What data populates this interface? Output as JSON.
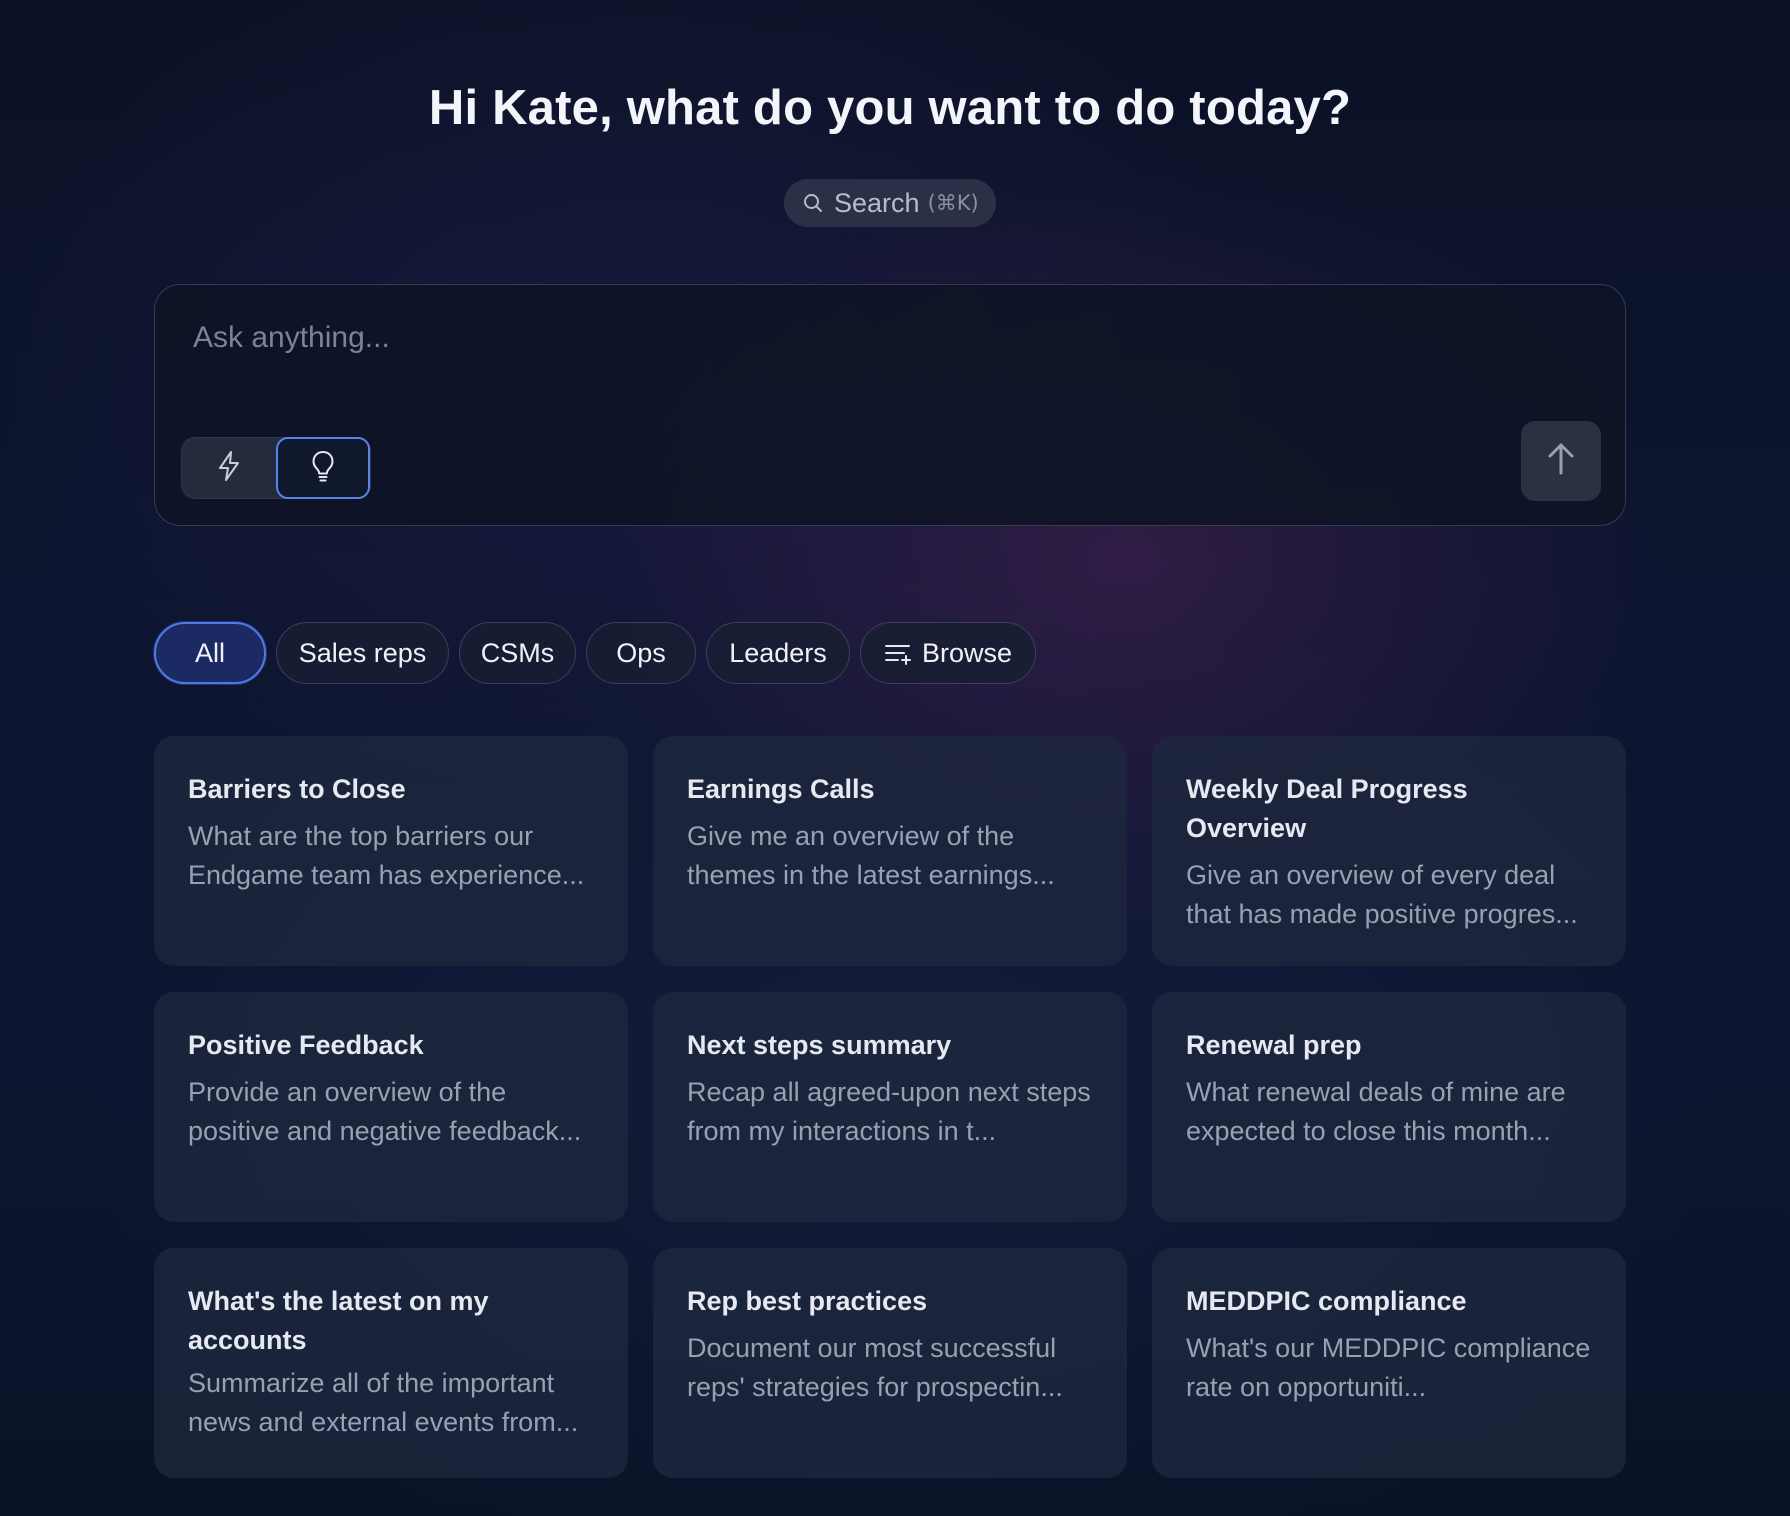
{
  "header": {
    "greeting": "Hi Kate, what do you want to do today?"
  },
  "search": {
    "label": "Search",
    "shortcut": "(⌘K)"
  },
  "ask": {
    "placeholder": "Ask anything...",
    "value": ""
  },
  "mode_toggle": {
    "options": [
      {
        "icon": "lightning-icon",
        "selected": false
      },
      {
        "icon": "lightbulb-icon",
        "selected": true
      }
    ]
  },
  "send_button": {
    "icon": "arrow-up-icon"
  },
  "filters": [
    {
      "label": "All",
      "selected": true
    },
    {
      "label": "Sales reps",
      "selected": false
    },
    {
      "label": "CSMs",
      "selected": false
    },
    {
      "label": "Ops",
      "selected": false
    },
    {
      "label": "Leaders",
      "selected": false
    },
    {
      "label": "Browse",
      "selected": false,
      "icon": "list-add-icon"
    }
  ],
  "cards": [
    {
      "title": "Barriers to Close",
      "description": "What are the top barriers our Endgame team has experience..."
    },
    {
      "title": "Earnings Calls",
      "description": "Give me an overview of the themes in the latest earnings..."
    },
    {
      "title": "Weekly Deal Progress Overview",
      "description": "Give an overview of every deal that has made positive progres..."
    },
    {
      "title": "Positive Feedback",
      "description": "Provide an overview of the positive and negative feedback..."
    },
    {
      "title": "Next steps summary",
      "description": "Recap all agreed-upon next steps from my interactions in t..."
    },
    {
      "title": "Renewal prep",
      "description": "What renewal deals of mine are expected to close this month..."
    },
    {
      "title": "What's the latest on my accounts",
      "description": "Summarize all of the important news and external events from..."
    },
    {
      "title": "Rep best practices",
      "description": "Document our most successful reps' strategies for prospectin..."
    },
    {
      "title": "MEDDPIC compliance",
      "description": "What's our MEDDPIC compliance rate on opportuniti..."
    }
  ],
  "colors": {
    "accent": "#4f78e8",
    "chip_active_bg": "#1c2a63",
    "card_bg": "#1e283e",
    "background": "#0c1630"
  }
}
